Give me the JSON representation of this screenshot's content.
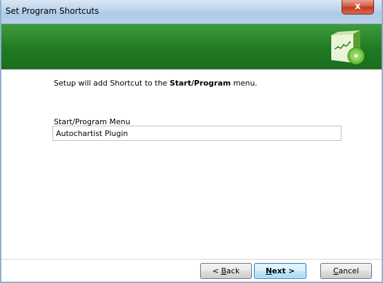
{
  "window": {
    "title": "Set Program Shortcuts",
    "close_glyph": "x"
  },
  "banner": {
    "icon": "software-box-icon"
  },
  "content": {
    "intro_prefix": "Setup will add Shortcut to the ",
    "intro_bold": "Start/Program",
    "intro_suffix": " menu.",
    "field_label": "Start/Program Menu",
    "field_value": "Autochartist Plugin"
  },
  "buttons": {
    "back_prefix": "< ",
    "back_u": "B",
    "back_rest": "ack",
    "next_u": "N",
    "next_rest": "ext >",
    "cancel_u": "C",
    "cancel_rest": "ancel"
  }
}
